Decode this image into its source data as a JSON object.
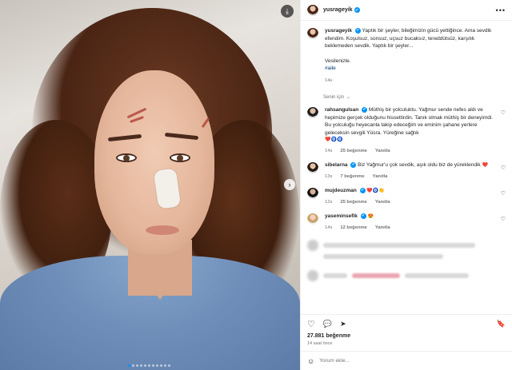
{
  "post": {
    "author": "yusrageyik",
    "verified_mark": "✔",
    "more_label": "•••",
    "download_icon": "⤓",
    "next_icon": "›",
    "carousel": {
      "count": 11,
      "active_index": 0
    }
  },
  "caption": {
    "username": "yusrageyik",
    "text": "Yaptık bir şeyler, bileğimizin gücü yettiğince. Ama sevdik efendim. Koşulsuz, sonsuz, uçsuz bucaksız, tereddütsüz, karşılık beklemeden sevdik. Yaptık bir şeyler...",
    "closing": "Vesilenizle.",
    "hashtag": "#aile",
    "time": "14s"
  },
  "section_label": "Senin için",
  "comments": [
    {
      "username": "rahsangulsan",
      "text": "Müthiş bir yolculuktu. Yağmur sende nefes aldı ve hepimize gerçek olduğunu hissettirdin. Tanık olmak müthiş bir deneyimdi. Bu yolculuğu heyecanla takip edeceğim ve eminim şahane yerlere geleceksin sevgili Yüsra. Yüreğine sağlık",
      "emojis": "❤️🧿🧿",
      "time": "14s",
      "likes": "25 beğenme",
      "reply": "Yanıtla"
    },
    {
      "username": "sibelarna",
      "text": "Biz Yağmur'u çok sevdik, aşık oldu biz de yüreklendik",
      "emojis": "❤️",
      "time": "13s",
      "likes": "7 beğenme",
      "reply": "Yanıtla"
    },
    {
      "username": "mujdeuzman",
      "text": "",
      "emojis": "❤️🧿👏",
      "time": "12s",
      "likes": "25 beğenme",
      "reply": "Yanıtla"
    },
    {
      "username": "yaseminsefik",
      "text": "",
      "emojis": "😍",
      "time": "14s",
      "likes": "12 beğenme",
      "reply": "Yanıtla"
    }
  ],
  "icons": {
    "heart": "♡",
    "comment": "💬",
    "share": "➤",
    "save": "🔖",
    "smile": "☺"
  },
  "stats": {
    "likes": "27.881 beğenme",
    "posted": "14 saat önce"
  },
  "comment_input": {
    "placeholder": "Yorum ekle..."
  },
  "colors": {
    "accent": "#0095f6",
    "secondary_text": "#737373"
  }
}
